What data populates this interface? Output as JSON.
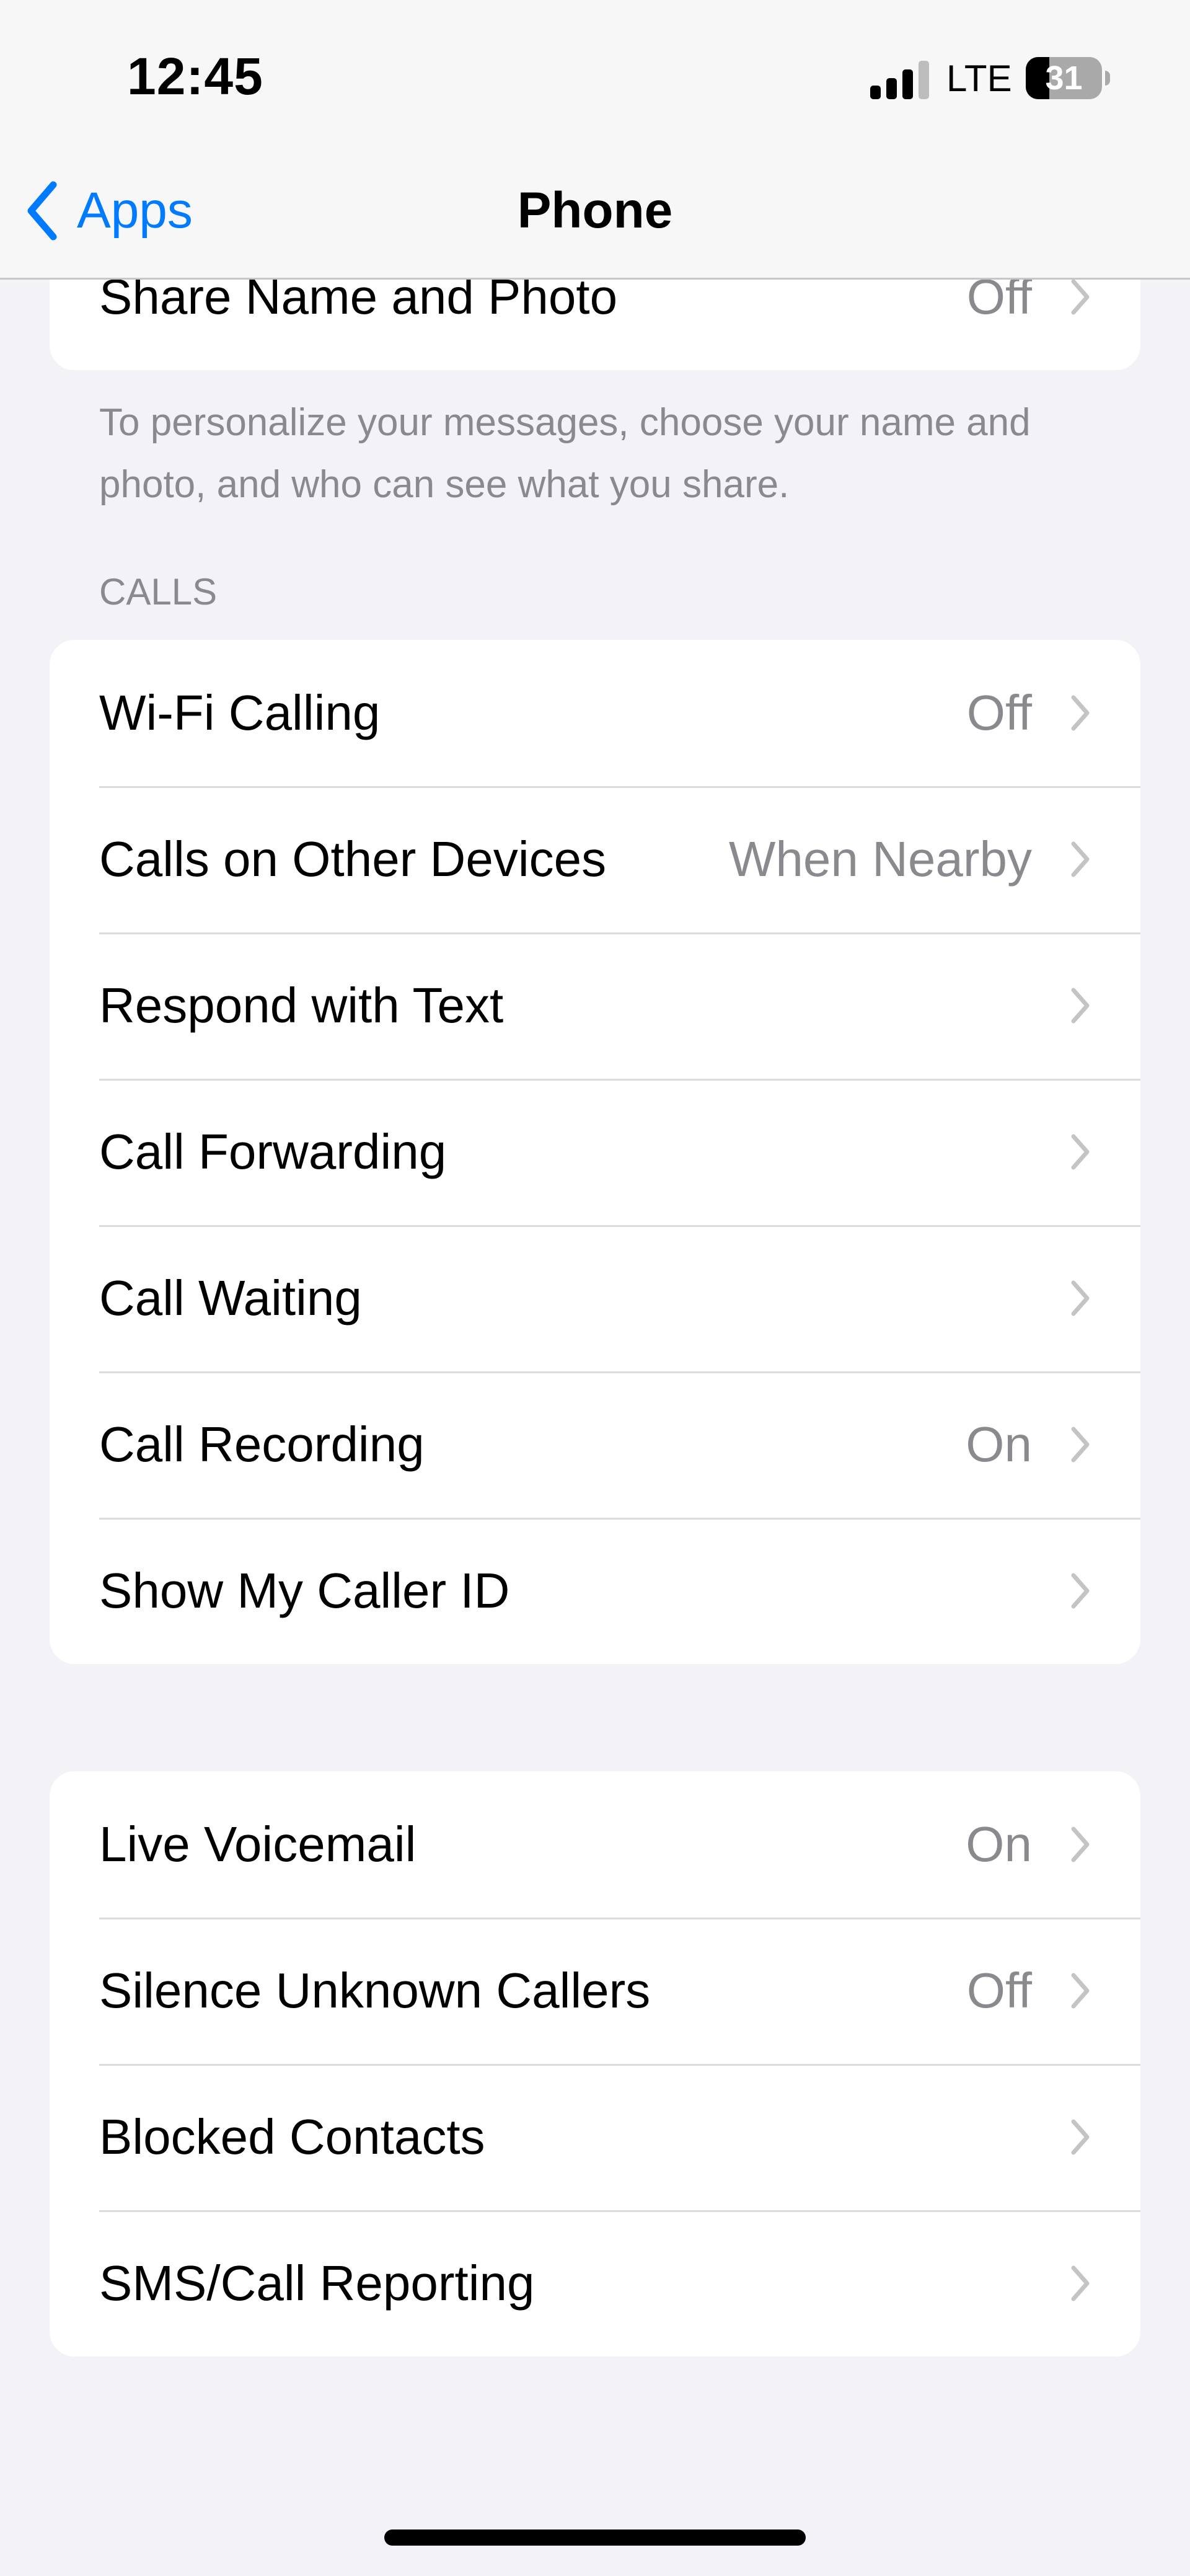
{
  "status_bar": {
    "time": "12:45",
    "signal_bars_active": 3,
    "signal_bars_total": 4,
    "network": "LTE",
    "battery_percent": "31"
  },
  "nav": {
    "back_label": "Apps",
    "title": "Phone"
  },
  "share_group": {
    "rows": [
      {
        "title": "Share Name and Photo",
        "value": "Off"
      }
    ],
    "footer": "To personalize your messages, choose your name and photo, and who can see what you share."
  },
  "calls_group": {
    "header": "CALLS",
    "rows": [
      {
        "title": "Wi-Fi Calling",
        "value": "Off"
      },
      {
        "title": "Calls on Other Devices",
        "value": "When Nearby"
      },
      {
        "title": "Respond with Text",
        "value": ""
      },
      {
        "title": "Call Forwarding",
        "value": ""
      },
      {
        "title": "Call Waiting",
        "value": ""
      },
      {
        "title": "Call Recording",
        "value": "On"
      },
      {
        "title": "Show My Caller ID",
        "value": ""
      }
    ]
  },
  "voicemail_group": {
    "rows": [
      {
        "title": "Live Voicemail",
        "value": "On"
      },
      {
        "title": "Silence Unknown Callers",
        "value": "Off"
      },
      {
        "title": "Blocked Contacts",
        "value": ""
      },
      {
        "title": "SMS/Call Reporting",
        "value": ""
      }
    ]
  },
  "colors": {
    "accent": "#007aff",
    "background": "#f2f2f7",
    "secondary_text": "#8a8a8e"
  }
}
